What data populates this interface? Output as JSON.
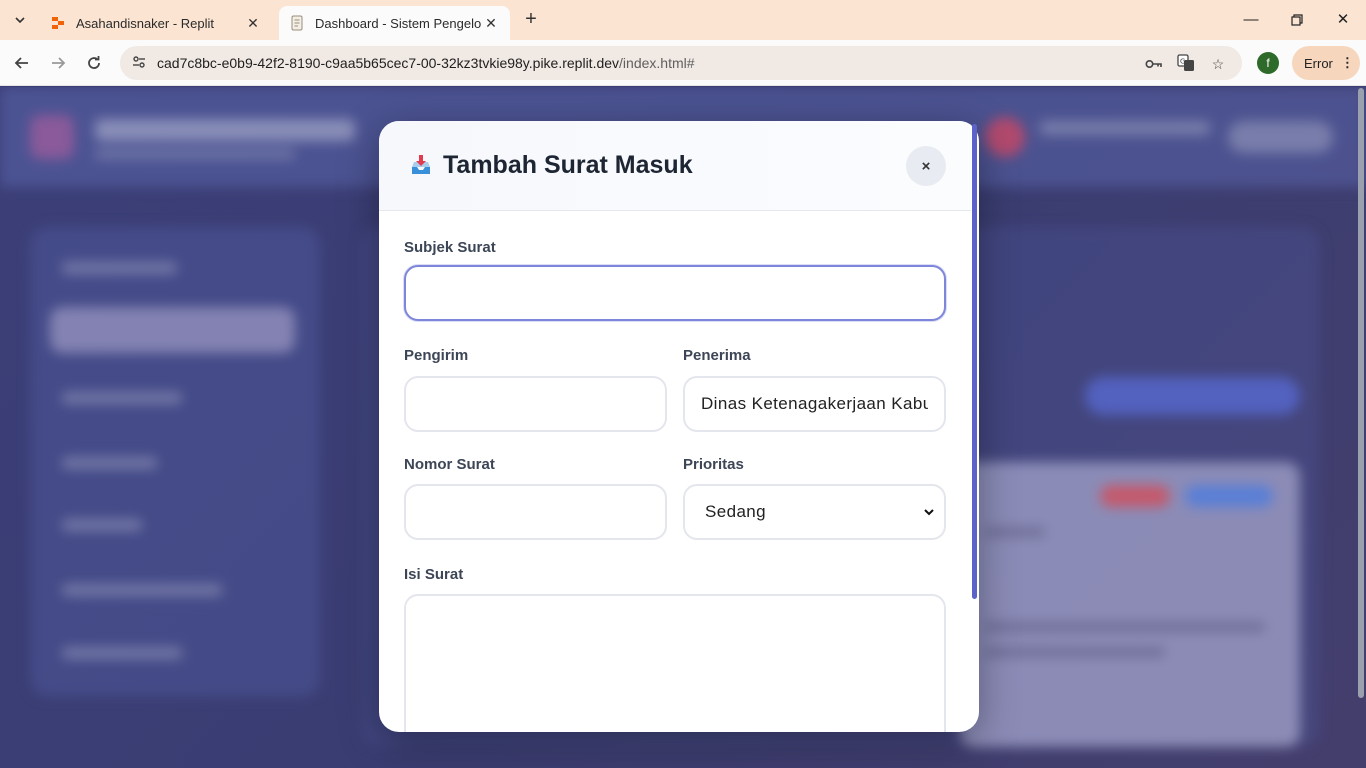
{
  "browser": {
    "tabs": [
      {
        "title": "Asahandisnaker - Replit",
        "active": false,
        "icon": "replit-icon"
      },
      {
        "title": "Dashboard - Sistem Pengelolaa",
        "active": true,
        "icon": "document-icon"
      }
    ],
    "url_main": "cad7c8bc-e0b9-42f2-8190-c9aa5b65cec7-00-32kz3tvkie98y.pike.replit.dev",
    "url_path": "/index.html#",
    "profile_initial": "f",
    "error_label": "Error"
  },
  "modal": {
    "title": "Tambah Surat Masuk",
    "icon": "inbox-tray-icon",
    "close_label": "×",
    "fields": {
      "subject": {
        "label": "Subjek Surat",
        "value": ""
      },
      "sender": {
        "label": "Pengirim",
        "value": ""
      },
      "recipient": {
        "label": "Penerima",
        "value": "Dinas Ketenagakerjaan Kabup"
      },
      "number": {
        "label": "Nomor Surat",
        "value": ""
      },
      "priority": {
        "label": "Prioritas",
        "value": "Sedang"
      },
      "content": {
        "label": "Isi Surat",
        "value": ""
      }
    }
  },
  "colors": {
    "accent": "#5c63c8",
    "focus_border": "#7d86d8",
    "overlay": "#3b3f73"
  }
}
